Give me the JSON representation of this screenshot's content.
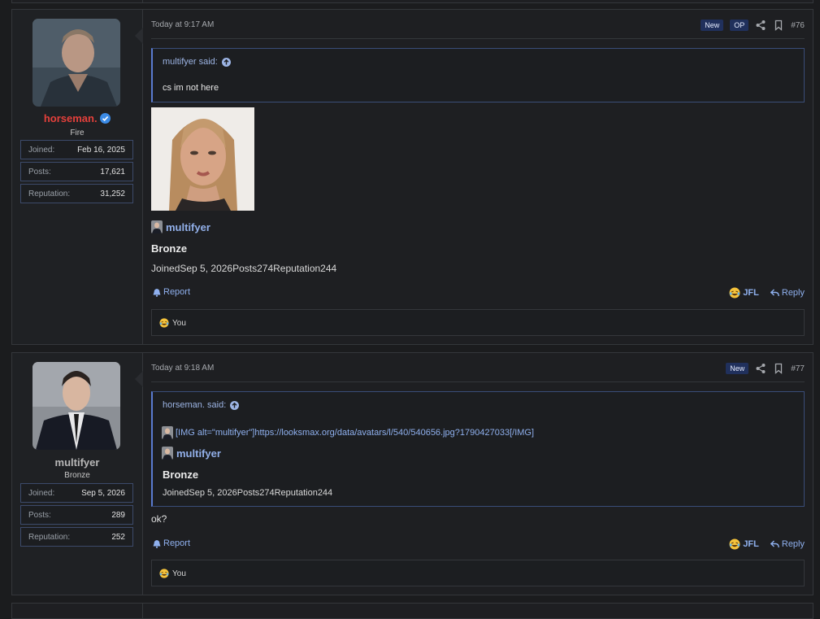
{
  "posts": [
    {
      "user": {
        "name": "horseman.",
        "name_color": "#e5403b",
        "title": "Fire",
        "verified": true,
        "stats": [
          {
            "label": "Joined:",
            "value": "Feb 16, 2025"
          },
          {
            "label": "Posts:",
            "value": "17,621"
          },
          {
            "label": "Reputation:",
            "value": "31,252"
          }
        ]
      },
      "time": "Today at 9:17 AM",
      "badges": [
        "New",
        "OP"
      ],
      "number": "#76",
      "quote": {
        "author": "multifyer said:",
        "text": "cs im not here"
      },
      "signature": {
        "name": "multifyer",
        "rank": "Bronze",
        "line": "JoinedSep 5, 2026Posts274Reputation244"
      },
      "actions": {
        "report": "Report",
        "jfl": "JFL",
        "reply": "Reply"
      },
      "reactions": "You"
    },
    {
      "user": {
        "name": "multifyer",
        "name_color": "#b8b8b8",
        "title": "Bronze",
        "verified": false,
        "stats": [
          {
            "label": "Joined:",
            "value": "Sep 5, 2026"
          },
          {
            "label": "Posts:",
            "value": "289"
          },
          {
            "label": "Reputation:",
            "value": "252"
          }
        ]
      },
      "time": "Today at 9:18 AM",
      "badges": [
        "New"
      ],
      "number": "#77",
      "quote": {
        "author": "horseman. said:",
        "img_code": "[IMG alt=\"multifyer\"]https://looksmax.org/data/avatars/l/540/540656.jpg?1790427033[/IMG]",
        "sig_name": "multifyer",
        "sig_rank": "Bronze",
        "sig_line": "JoinedSep 5, 2026Posts274Reputation244"
      },
      "body": "ok?",
      "actions": {
        "report": "Report",
        "jfl": "JFL",
        "reply": "Reply"
      },
      "reactions": "You"
    }
  ],
  "colors": {
    "accent": "#8fb0ee",
    "badge_bg": "#20305c",
    "verified": "#3b8be6"
  }
}
